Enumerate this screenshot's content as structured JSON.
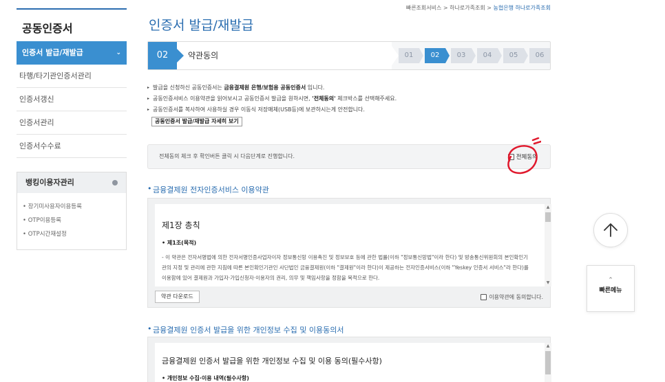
{
  "sidebar": {
    "title": "공동인증서",
    "items": [
      {
        "label": "인증서 발급/재발급"
      },
      {
        "label": "타행/타기관인증서관리"
      },
      {
        "label": "인증서갱신"
      },
      {
        "label": "인증서관리"
      },
      {
        "label": "인증서수수료"
      }
    ],
    "banking": {
      "title": "뱅킹이용자관리",
      "items": [
        "장기미사용자이용등록",
        "OTP이용등록",
        "OTP시간재설정"
      ]
    }
  },
  "breadcrumb": [
    "빠른조회서비스",
    "하나로가족조회",
    "농협은행 하나로가족조회"
  ],
  "page_title": "인증서 발급/재발급",
  "steps": {
    "current_num": "02",
    "current_name": "약관동의",
    "list": [
      "01",
      "02",
      "03",
      "04",
      "05",
      "06"
    ],
    "active": "02"
  },
  "notices": {
    "line1_a": "발급을 신청하신 공동인증서는 ",
    "line1_b": "금융결제원 은행/보험용 공동인증서",
    "line1_c": " 입니다.",
    "line2_a": "공동인증서비스 이용약관을 읽어보시고 공동인증서 발급을 원하시면, ",
    "line2_b": "'전체동의'",
    "line2_c": " 체크박스를 선택해주세요.",
    "line3": "공동인증서를 복사하여 사용하실 경우 이동식 저장매체(USB등)에 보관하시는게 안전합니다.",
    "detail_button": "공동인증서 발급/재발급 자세히 보기"
  },
  "agree_box": {
    "text": "전체동의 체크 후 확인버튼 클릭 시 다음단계로 진행합니다.",
    "agree_all": "전체동의"
  },
  "terms1": {
    "section_title": "금융결제원 전자인증서비스 이용약관",
    "chapter": "제1장 총칙",
    "article_title": "• 제1조(목적)",
    "article_body": "- 이 약관은 전자서명법에 의한 전자서명인증사업자이자 정보통신망 이용촉진 및 정보보호 등에 관한 법률(이하 \"정보통신망법\"이라 한다) 및 방송통신위원회의 본인확인기관의 지정 및 관리에 관한 지침에 따른 본인확인기관인 사단법인 금융결제원(이하 \"결제원\"이라 한다)이 제공하는 전자인증서비스(이하 \"Yeskey 인증서 서비스\"라 한다)를 이용함에 있어 결제원과 가입자·가입신청자·이용자의 권리, 의무 및 책임사항을 정함을 목적으로 한다.",
    "download_button": "약관 다운로드",
    "agree_label": "이용약관에 동의합니다."
  },
  "terms2": {
    "section_title": "금융결제원 인증서 발급을 위한 개인정보 수집 및 이용동의서",
    "consent_title": "금융결제원 인증서 발급을 위한 개인정보 수집 및 이용 동의(필수사항)",
    "consent_sub": "• 개인정보 수집·이용 내역(필수사항)"
  },
  "quick_menu": {
    "label": "빠른메뉴"
  },
  "colors": {
    "accent": "#3a8fd0",
    "title_blue": "#2a6db0",
    "annotation_red": "#e0192d"
  }
}
